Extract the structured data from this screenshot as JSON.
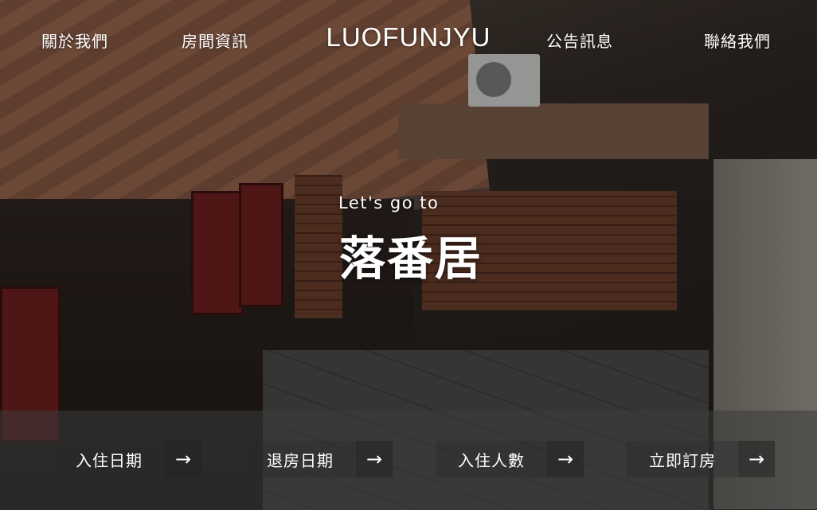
{
  "nav": {
    "about": "關於我們",
    "rooms": "房間資訊",
    "brand": "LUOFUNJYU",
    "news": "公告訊息",
    "contact": "聯絡我們"
  },
  "hero": {
    "tagline": "Let's go to",
    "title": "落番居"
  },
  "booking": {
    "checkin_label": "入住日期",
    "checkout_label": "退房日期",
    "guests_label": "入住人數",
    "book_label": "立即訂房",
    "arrow": "→"
  }
}
